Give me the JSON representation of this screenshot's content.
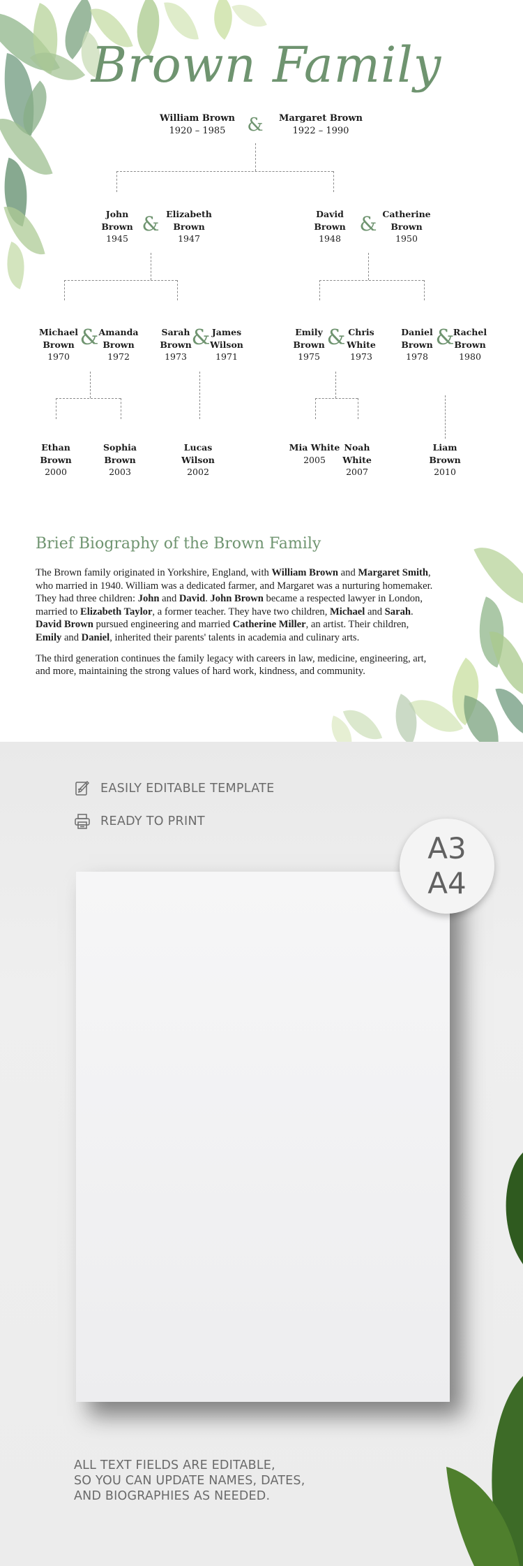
{
  "template": {
    "title": "Brown Family",
    "ampersand": "&",
    "generation1": {
      "husband": {
        "name": "William Brown",
        "years": "1920 – 1985"
      },
      "wife": {
        "name": "Margaret Brown",
        "years": "1922 – 1990"
      }
    },
    "generation2": [
      {
        "name1": "John",
        "name2": "Brown",
        "year": "1945"
      },
      {
        "name1": "Elizabeth",
        "name2": "Brown",
        "year": "1947"
      },
      {
        "name1": "David",
        "name2": "Brown",
        "year": "1948"
      },
      {
        "name1": "Catherine",
        "name2": "Brown",
        "year": "1950"
      }
    ],
    "generation3": [
      {
        "name1": "Michael",
        "name2": "Brown",
        "year": "1970"
      },
      {
        "name1": "Amanda",
        "name2": "Brown",
        "year": "1972"
      },
      {
        "name1": "Sarah",
        "name2": "Brown",
        "year": "1973"
      },
      {
        "name1": "James",
        "name2": "Wilson",
        "year": "1971"
      },
      {
        "name1": "Emily",
        "name2": "Brown",
        "year": "1975"
      },
      {
        "name1": "Chris",
        "name2": "White",
        "year": "1973"
      },
      {
        "name1": "Daniel",
        "name2": "Brown",
        "year": "1978"
      },
      {
        "name1": "Rachel",
        "name2": "Brown",
        "year": "1980"
      }
    ],
    "generation4": [
      {
        "name1": "Ethan",
        "name2": "Brown",
        "year": "2000"
      },
      {
        "name1": "Sophia",
        "name2": "Brown",
        "year": "2003"
      },
      {
        "name1": "Lucas",
        "name2": "Wilson",
        "year": "2002"
      },
      {
        "name1": "Mia White",
        "name2": "",
        "year": "2005"
      },
      {
        "name1": "Noah",
        "name2": "White",
        "year": "2007"
      },
      {
        "name1": "Liam",
        "name2": "Brown",
        "year": "2010"
      }
    ],
    "biography": {
      "heading": "Brief Biography of the Brown Family",
      "paragraph1": [
        {
          "t": "The Brown family originated in Yorkshire, England, with ",
          "b": false
        },
        {
          "t": "William Brown",
          "b": true
        },
        {
          "t": " and ",
          "b": false
        },
        {
          "t": "Margaret Smith",
          "b": true
        },
        {
          "t": ", who married in 1940. William was a dedicated farmer, and Margaret was a nurturing homemaker. They had three children: ",
          "b": false
        },
        {
          "t": "John",
          "b": true
        },
        {
          "t": " and ",
          "b": false
        },
        {
          "t": "David",
          "b": true
        },
        {
          "t": ". ",
          "b": false
        },
        {
          "t": "John Brown",
          "b": true
        },
        {
          "t": " became a respected lawyer in London, married to ",
          "b": false
        },
        {
          "t": "Elizabeth Taylor",
          "b": true
        },
        {
          "t": ", a former teacher. They have two children, ",
          "b": false
        },
        {
          "t": "Michael",
          "b": true
        },
        {
          "t": " and ",
          "b": false
        },
        {
          "t": "Sarah",
          "b": true
        },
        {
          "t": ". ",
          "b": false
        },
        {
          "t": "David Brown",
          "b": true
        },
        {
          "t": " pursued engineering and married ",
          "b": false
        },
        {
          "t": "Catherine Miller",
          "b": true
        },
        {
          "t": ", an artist. Their children, ",
          "b": false
        },
        {
          "t": "Emily",
          "b": true
        },
        {
          "t": " and ",
          "b": false
        },
        {
          "t": "Daniel",
          "b": true
        },
        {
          "t": ", inherited their parents' talents in academia and culinary arts.",
          "b": false
        }
      ],
      "paragraph2": "The third generation continues the family legacy with careers in law, medicine, engineering, art, and more, maintaining the strong values of hard work, kindness, and community."
    }
  },
  "promo": {
    "features": [
      {
        "icon": "edit-document-icon",
        "label": "EASILY EDITABLE TEMPLATE"
      },
      {
        "icon": "printer-icon",
        "label": "READY TO PRINT"
      }
    ],
    "sizes_badge": [
      "A3",
      "A4"
    ],
    "footer_lines": [
      "ALL TEXT FIELDS ARE EDITABLE,",
      "SO YOU CAN UPDATE NAMES, DATES,",
      "AND BIOGRAPHIES AS NEEDED."
    ]
  },
  "colors": {
    "accent_green": "#6f9470",
    "text_dark": "#1c1c1c",
    "promo_text": "#6b6b6b",
    "connector": "#8a8a8a"
  }
}
